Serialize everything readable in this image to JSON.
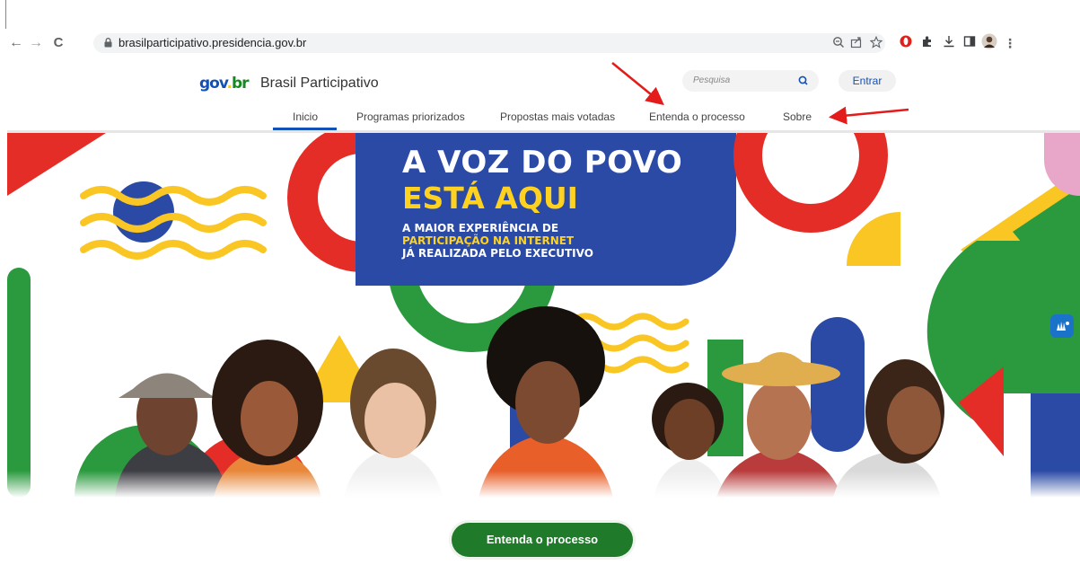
{
  "browser": {
    "url": "brasilparticipativo.presidencia.gov.br",
    "nav": {
      "back": "←",
      "forward": "→",
      "reload": "C"
    }
  },
  "site": {
    "logo": {
      "gov": "gov",
      "dot": ".",
      "br": "br"
    },
    "title": "Brasil Participativo",
    "search_placeholder": "Pesquisa",
    "login_label": "Entrar",
    "menu": [
      {
        "label": "Inicio",
        "active": true
      },
      {
        "label": "Programas priorizados",
        "active": false
      },
      {
        "label": "Propostas mais votadas",
        "active": false
      },
      {
        "label": "Entenda o processo",
        "active": false
      },
      {
        "label": "Sobre",
        "active": false
      }
    ]
  },
  "hero": {
    "title_line1": "A VOZ DO POVO",
    "title_line2": "ESTÁ AQUI",
    "sub_line1": "A MAIOR EXPERIÊNCIA DE",
    "sub_line2": "PARTICIPAÇÃO NA INTERNET",
    "sub_line3": "JÁ REALIZADA PELO EXECUTIVO"
  },
  "cta_label": "Entenda o processo",
  "colors": {
    "gov_blue": "#1351b4",
    "gov_yellow": "#ffcd07",
    "gov_green": "#168821",
    "hero_blue": "#2a4aa6",
    "hero_red": "#e52d27",
    "hero_yellow": "#f9c623",
    "hero_green": "#2b9a3e",
    "cta_green": "#1f7a2a",
    "annotation_red": "#e31b1b"
  }
}
